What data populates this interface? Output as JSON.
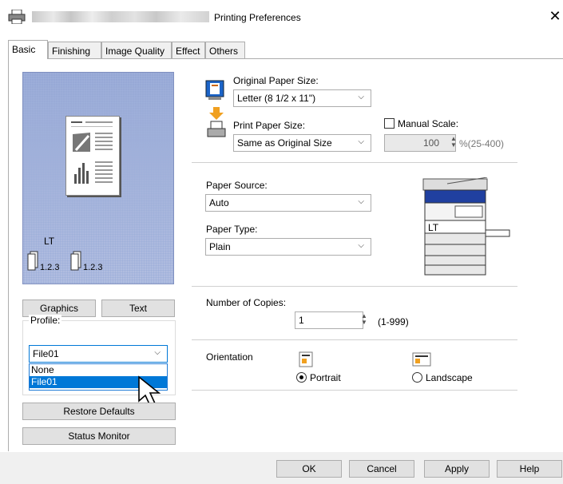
{
  "window": {
    "title": "Printing Preferences",
    "close": "✕"
  },
  "tabs": [
    "Basic",
    "Finishing",
    "Image Quality",
    "Effect",
    "Others"
  ],
  "preview": {
    "paper_label": "LT",
    "copies_label_1": "1.2.3",
    "copies_label_2": "1.2.3"
  },
  "left_buttons": {
    "graphics": "Graphics",
    "text": "Text",
    "restore_defaults": "Restore Defaults",
    "status_monitor": "Status Monitor"
  },
  "profile": {
    "label": "Profile:",
    "value": "File01",
    "options": [
      "None",
      "File01"
    ],
    "selected": "File01"
  },
  "paper": {
    "original_label": "Original Paper Size:",
    "original_value": "Letter (8 1/2 x 11\")",
    "print_label": "Print Paper Size:",
    "print_value": "Same as Original Size",
    "manual_scale_label": "Manual Scale:",
    "scale_value": "100",
    "scale_range": "%(25-400)"
  },
  "source": {
    "label": "Paper Source:",
    "value": "Auto"
  },
  "type": {
    "label": "Paper Type:",
    "value": "Plain"
  },
  "machine": {
    "tray_label": "LT"
  },
  "copies": {
    "label": "Number of Copies:",
    "value": "1",
    "range": "(1-999)"
  },
  "orientation": {
    "label": "Orientation",
    "portrait": "Portrait",
    "landscape": "Landscape",
    "selected": "Portrait"
  },
  "footer": {
    "ok": "OK",
    "cancel": "Cancel",
    "apply": "Apply",
    "help": "Help"
  }
}
